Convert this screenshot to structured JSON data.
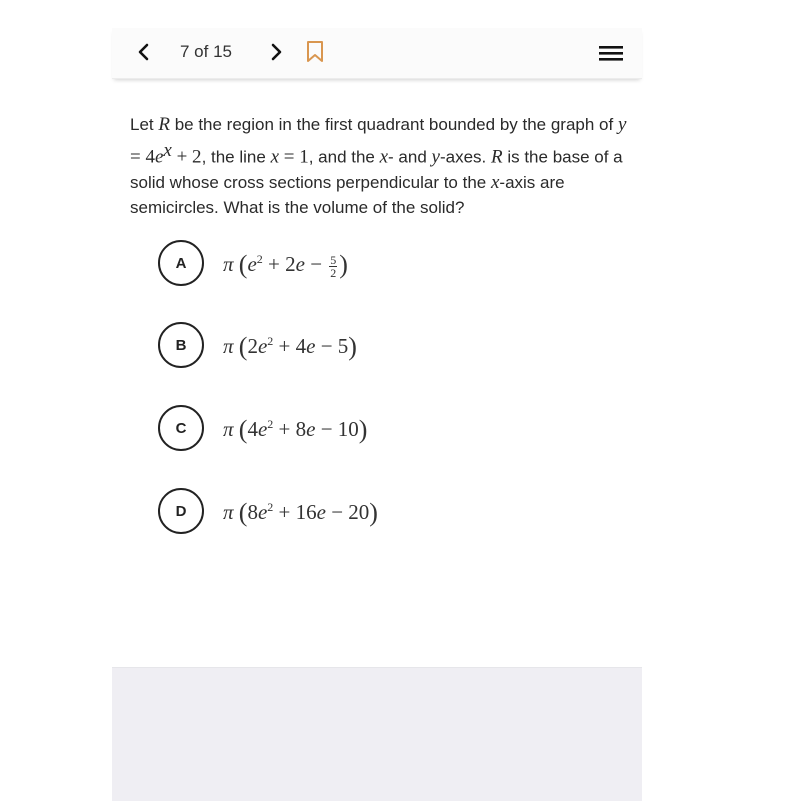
{
  "header": {
    "counter": "7 of 15",
    "prev_icon": "chevron-left-icon",
    "next_icon": "chevron-right-icon",
    "bookmark_icon": "bookmark-icon",
    "menu_icon": "hamburger-menu-icon",
    "bookmark_color": "#d9964f"
  },
  "question": {
    "p1": "Let ",
    "R": "R",
    "p2": " be the region in the first quadrant bounded by the graph of ",
    "eq1_lhs": "y",
    "eq1_eq": " = 4",
    "eq1_e": "e",
    "eq1_exp": "x",
    "eq1_rest": " + 2",
    "p3": ", the line ",
    "eq2_x": "x",
    "eq2_rest": " = 1",
    "p4": ", and the ",
    "x1": "x",
    "p5": "- and ",
    "y1": "y",
    "p6": "-axes. ",
    "R2": "R",
    "p7": " is the base of a solid whose cross sections perpendicular to the ",
    "x2": "x",
    "p8": "-axis are semicircles. What is the volume of the solid?"
  },
  "choices": [
    {
      "letter": "A",
      "pi": "π",
      "t1": "e",
      "t1sup": "2",
      "t2": " + 2",
      "t2e": "e",
      "t3": " − ",
      "frac_num": "5",
      "frac_den": "2"
    },
    {
      "letter": "B",
      "pi": "π",
      "pre": "2",
      "t1": "e",
      "t1sup": "2",
      "t2": " + 4",
      "t2e": "e",
      "t3": " − 5"
    },
    {
      "letter": "C",
      "pi": "π",
      "pre": "4",
      "t1": "e",
      "t1sup": "2",
      "t2": " + 8",
      "t2e": "e",
      "t3": " − 10"
    },
    {
      "letter": "D",
      "pi": "π",
      "pre": "8",
      "t1": "e",
      "t1sup": "2",
      "t2": " + 16",
      "t2e": "e",
      "t3": " − 20"
    }
  ]
}
